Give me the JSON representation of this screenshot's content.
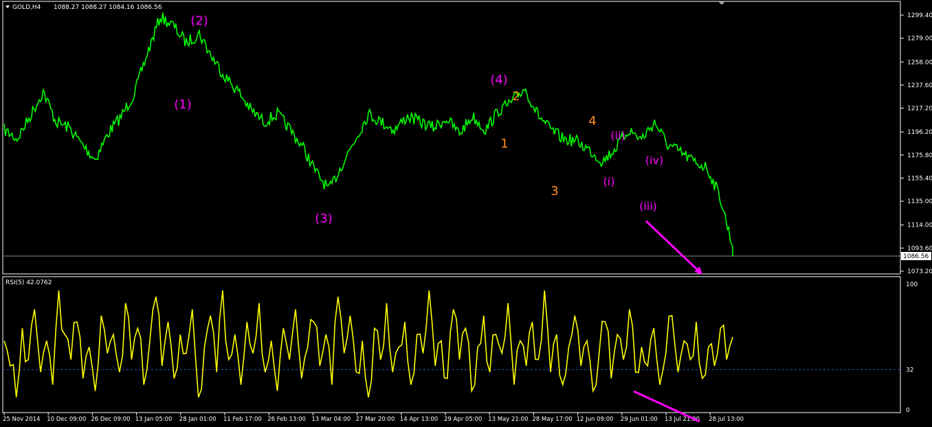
{
  "header": {
    "symbol_label": "GOLD,H4",
    "ohlc_label": "1088.27 1088.27 1084.16 1086.56"
  },
  "rsi_panel": {
    "label": "RSI(5) 42.0762"
  },
  "current_price_label": "1086.56",
  "colors": {
    "background": "#000000",
    "price_line": "#00ff00",
    "rsi_line": "#ffff00",
    "wave_label_primary": "#ff00ff",
    "wave_label_secondary": "#ff8c1a",
    "arrow": "#ff00ff",
    "axis": "#ffffff",
    "grid_level": "#1f3f8f"
  },
  "chart_data": [
    {
      "type": "line",
      "title": "GOLD,H4",
      "series": [
        {
          "name": "GOLD",
          "x": [
            0,
            3,
            6,
            9,
            12,
            15,
            18,
            21,
            24,
            27,
            30,
            33,
            36,
            39,
            42,
            45,
            48,
            51,
            54,
            57,
            60,
            63,
            66,
            69,
            72,
            75,
            78,
            81,
            84,
            87,
            90,
            93,
            96,
            99,
            102,
            105,
            108,
            111,
            114,
            117,
            120,
            123,
            126,
            129,
            132,
            135,
            138,
            141,
            144,
            147,
            150,
            153,
            156,
            159,
            162,
            165,
            168
          ],
          "values": [
            1198,
            1190,
            1210,
            1232,
            1205,
            1200,
            1185,
            1172,
            1195,
            1210,
            1230,
            1265,
            1298,
            1290,
            1275,
            1283,
            1262,
            1245,
            1232,
            1215,
            1205,
            1212,
            1198,
            1182,
            1160,
            1145,
            1168,
            1190,
            1212,
            1205,
            1198,
            1210,
            1205,
            1200,
            1208,
            1195,
            1210,
            1198,
            1215,
            1222,
            1235,
            1212,
            1198,
            1190,
            1188,
            1180,
            1170,
            1182,
            1198,
            1190,
            1205,
            1185,
            1178,
            1170,
            1165,
            1140,
            1095
          ]
        }
      ],
      "x_tick_labels": [
        "25 Nov 2014",
        "10 Dec 09:00",
        "26 Dec 09:00",
        "13 Jan 05:00",
        "28 Jan 01:00",
        "11 Feb 17:00",
        "26 Feb 13:00",
        "13 Mar 04:00",
        "27 Mar 20:00",
        "14 Apr 13:00",
        "29 Apr 05:00",
        "13 May 21:00",
        "28 May 17:00",
        "12 Jun 09:00",
        "29 Jun 01:00",
        "13 Jul 21:00",
        "28 Jul 13:00"
      ],
      "y_tick_labels": [
        "1299.40",
        "1279.00",
        "1258.00",
        "1237.60",
        "1217.20",
        "1196.20",
        "1175.80",
        "1155.40",
        "1135.00",
        "1114.00",
        "1093.60",
        "1073.20"
      ],
      "ylim": [
        1073.2,
        1299.4
      ],
      "current_value": 1086.56,
      "annotations": [
        {
          "text": "(2)",
          "kind": "primary"
        },
        {
          "text": "(1)",
          "kind": "primary"
        },
        {
          "text": "(3)",
          "kind": "primary"
        },
        {
          "text": "(4)",
          "kind": "primary"
        },
        {
          "text": "2",
          "kind": "secondary"
        },
        {
          "text": "1",
          "kind": "secondary"
        },
        {
          "text": "3",
          "kind": "secondary"
        },
        {
          "text": "4",
          "kind": "secondary"
        },
        {
          "text": "(ii)",
          "kind": "primary"
        },
        {
          "text": "(i)",
          "kind": "primary"
        },
        {
          "text": "(iv)",
          "kind": "primary"
        },
        {
          "text": "(iii)",
          "kind": "primary"
        }
      ]
    },
    {
      "type": "line",
      "title": "RSI(5) 42.0762",
      "series": [
        {
          "name": "RSI(5)",
          "values": [
            55,
            35,
            10,
            65,
            40,
            80,
            30,
            55,
            20,
            95,
            60,
            40,
            70,
            25,
            50,
            15,
            75,
            45,
            60,
            30,
            85,
            40,
            65,
            20,
            55,
            90,
            35,
            70,
            25,
            60,
            45,
            80,
            10,
            50,
            75,
            30,
            95,
            40,
            60,
            20,
            70,
            45,
            85,
            30,
            55,
            15,
            65,
            40,
            80,
            25,
            50,
            70,
            35,
            60,
            20,
            90,
            45,
            75,
            30,
            55,
            10,
            65,
            40,
            85,
            30,
            50,
            70,
            20,
            60,
            45,
            95,
            35,
            55,
            25,
            80,
            40,
            65,
            15,
            50,
            75,
            30,
            60,
            45,
            85,
            20,
            55,
            35,
            70,
            40,
            95,
            30,
            60,
            20,
            50,
            75,
            35,
            55,
            15,
            45,
            70,
            25,
            60,
            40,
            80,
            30,
            50,
            35,
            65,
            20,
            45,
            75,
            30,
            55,
            40,
            70,
            25,
            50,
            35,
            65,
            40,
            58
          ]
        }
      ],
      "y_tick_labels": [
        "100",
        "32",
        "0"
      ],
      "ylim": [
        0,
        100
      ],
      "level_line": 32
    }
  ]
}
